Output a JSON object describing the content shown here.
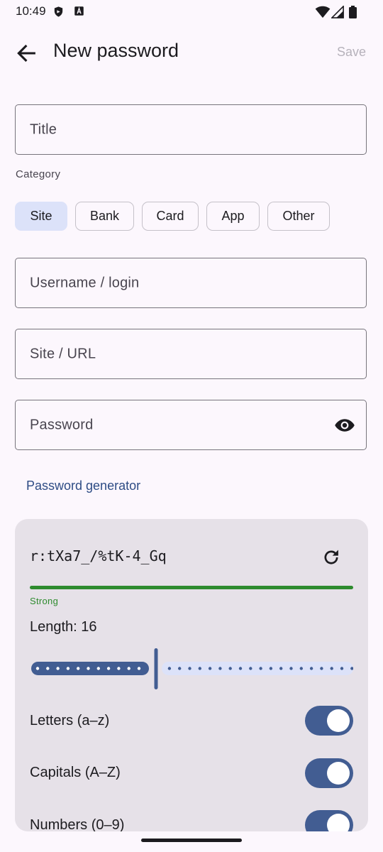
{
  "status_bar": {
    "time": "10:49"
  },
  "app_bar": {
    "title": "New password",
    "save_label": "Save"
  },
  "form": {
    "title_placeholder": "Title",
    "category_label": "Category",
    "categories": [
      {
        "label": "Site",
        "selected": true
      },
      {
        "label": "Bank",
        "selected": false
      },
      {
        "label": "Card",
        "selected": false
      },
      {
        "label": "App",
        "selected": false
      },
      {
        "label": "Other",
        "selected": false
      }
    ],
    "username_placeholder": "Username / login",
    "url_placeholder": "Site / URL",
    "password_placeholder": "Password",
    "generator_link": "Password generator"
  },
  "generator": {
    "generated_password": "r:tXa7_/%tK-4_Gq",
    "strength": "Strength",
    "strength_label": "Strong",
    "length_label": "Length: 16",
    "length_value": 16,
    "options": [
      {
        "label": "Letters (a–z)",
        "enabled": true
      },
      {
        "label": "Capitals (A–Z)",
        "enabled": true
      },
      {
        "label": "Numbers (0–9)",
        "enabled": true
      }
    ]
  },
  "colors": {
    "accent": "#425D92",
    "strength_green": "#2E8B2E",
    "chip_selected": "#DCE2F9",
    "card_bg": "#E6E1E8"
  }
}
